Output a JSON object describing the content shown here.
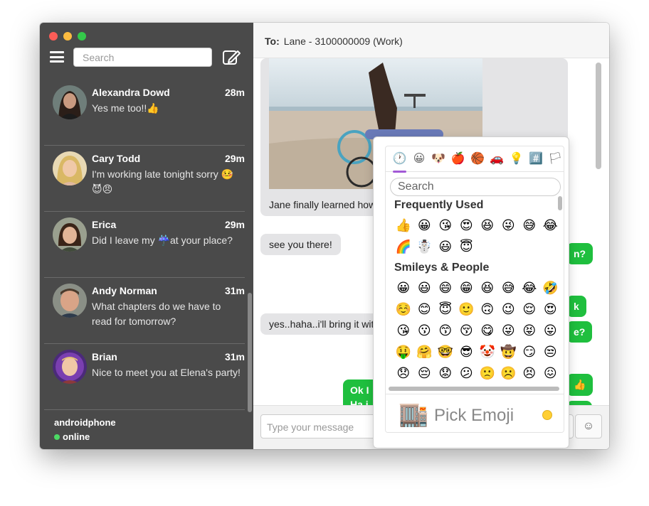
{
  "window": {
    "traffic_lights": [
      "close",
      "minimize",
      "zoom"
    ]
  },
  "sidebar": {
    "search_placeholder": "Search",
    "conversations": [
      {
        "name": "Alexandra Dowd",
        "time": "28m",
        "preview": "Yes me too!!👍"
      },
      {
        "name": "Cary Todd",
        "time": "29m",
        "preview": "I'm working late tonight sorry 🤒 😈😠"
      },
      {
        "name": "Erica",
        "time": "29m",
        "preview": "Did I leave my ☔️at your place?"
      },
      {
        "name": "Andy Norman",
        "time": "31m",
        "preview": "What chapters do we have to read for tomorrow?"
      },
      {
        "name": "Brian",
        "time": "31m",
        "preview": "Nice to meet you at Elena's party!"
      }
    ],
    "account": {
      "name": "androidphone",
      "status": "online"
    }
  },
  "header": {
    "to_label": "To:",
    "recipient": "Lane - 3100000009 (Work)"
  },
  "messages": {
    "photo_caption": "Jane finally learned how",
    "incoming": [
      "see you there!",
      "yes..haha..i'll bring it wit"
    ],
    "outgoing_partial": [
      "n?",
      "k",
      "e?",
      "👍",
      "e?",
      "Ok I",
      "Ha i"
    ]
  },
  "composer": {
    "placeholder": "Type your message",
    "emoji_button": "☺"
  },
  "emoji_picker": {
    "categories": [
      "🕐",
      "😀",
      "🐶",
      "🍎",
      "🏀",
      "🚗",
      "💡",
      "#️⃣",
      "🏳"
    ],
    "search_placeholder": "Search",
    "frequently_used_title": "Frequently Used",
    "frequently_used": [
      "👍",
      "😀",
      "😘",
      "😍",
      "😆",
      "😜",
      "😅",
      "😂",
      "🌈",
      "☃️",
      "😃",
      "😇"
    ],
    "smileys_title": "Smileys & People",
    "smileys": [
      "😀",
      "😃",
      "😄",
      "😁",
      "😆",
      "😅",
      "😂",
      "🤣",
      "☺️",
      "😊",
      "😇",
      "🙂",
      "🙃",
      "😉",
      "😌",
      "😍",
      "😘",
      "😗",
      "😙",
      "😚",
      "😋",
      "😜",
      "😝",
      "😛",
      "🤑",
      "🤗",
      "🤓",
      "😎",
      "🤡",
      "🤠",
      "😏",
      "😒",
      "😞",
      "😔",
      "😟",
      "😕",
      "🙁",
      "☹️",
      "😣",
      "😖"
    ],
    "preview_emoji": "🏬",
    "preview_label": "Pick Emoji"
  }
}
